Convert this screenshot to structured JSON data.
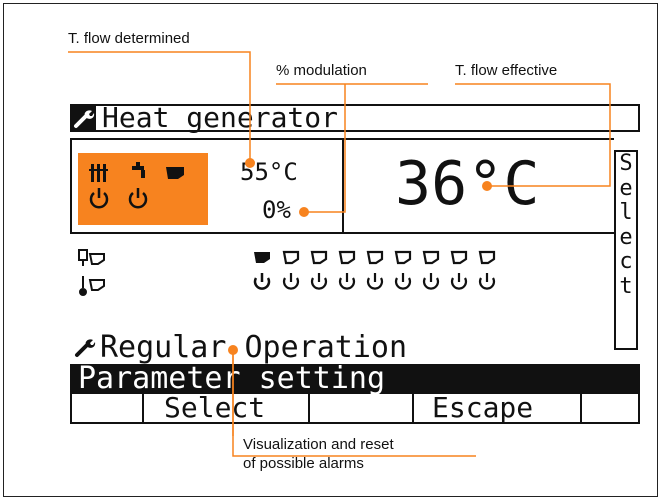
{
  "callouts": {
    "t_flow_determined": "T. flow determined",
    "modulation": "% modulation",
    "t_flow_effective": "T. flow effective",
    "alarms_line1": "Visualization and reset",
    "alarms_line2": "of possible alarms"
  },
  "screen": {
    "title": "Heat generator",
    "flow_temp_set": "55°C",
    "modulation_value": "0%",
    "flow_temp_effective": "36°C",
    "side_button_letters": [
      "S",
      "e",
      "l",
      "e",
      "c",
      "t"
    ],
    "status_line": "Regular Operation",
    "menu_item": "Parameter setting",
    "softkeys": [
      "",
      "Select",
      "",
      "Escape",
      ""
    ]
  },
  "colors": {
    "accent_orange": "#f7831f",
    "lcd_ink": "#111111",
    "background": "#ffffff"
  },
  "icons": {
    "title": "wrench-icon",
    "status": "wrench-icon",
    "heating": "radiator-icon",
    "dhw": "tap-icon",
    "burner": "flame-icon",
    "power": "power-icon",
    "sensor_outdoor": "outdoor-sensor-icon",
    "sensor_temp": "thermometer-icon",
    "zone": "valve-icon"
  }
}
